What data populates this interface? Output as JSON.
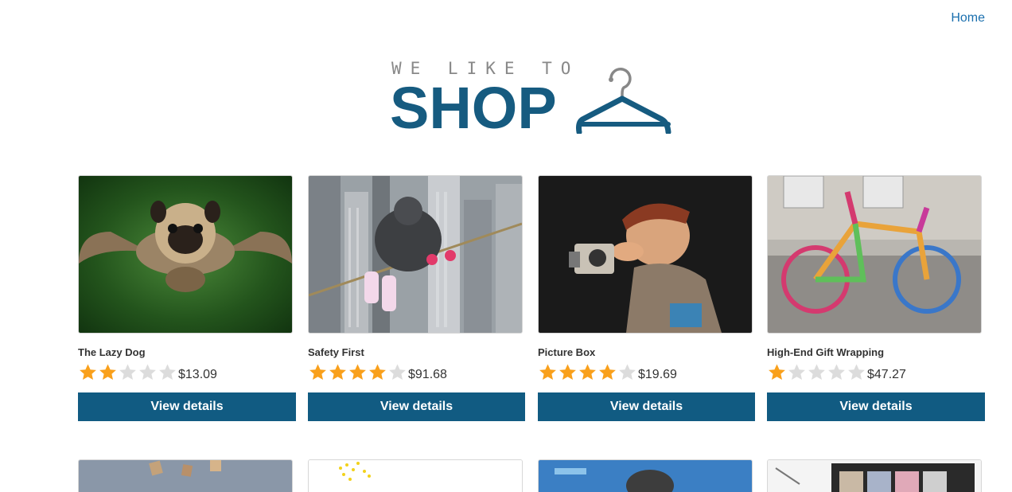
{
  "nav": {
    "home_label": "Home"
  },
  "logo": {
    "tagline": "WE LIKE TO",
    "brand": "SHOP"
  },
  "colors": {
    "accent": "#115b82",
    "link": "#1a6fae",
    "star_on": "#f9a01b",
    "star_off": "#dcdcdc"
  },
  "products": [
    {
      "title": "The Lazy Dog",
      "rating": 2,
      "price": "$13.09",
      "button": "View details",
      "image": "flying-pug"
    },
    {
      "title": "Safety First",
      "rating": 4,
      "price": "$91.68",
      "button": "View details",
      "image": "tightrope-city"
    },
    {
      "title": "Picture Box",
      "rating": 4,
      "price": "$19.69",
      "button": "View details",
      "image": "photographer-figure"
    },
    {
      "title": "High-End Gift Wrapping",
      "rating": 1,
      "price": "$47.27",
      "button": "View details",
      "image": "knitted-bicycle"
    }
  ],
  "products_row2": [
    {
      "image": "books-sky"
    },
    {
      "image": "yellow-dots"
    },
    {
      "image": "blue-sky-figure"
    },
    {
      "image": "makeup-palette"
    }
  ]
}
